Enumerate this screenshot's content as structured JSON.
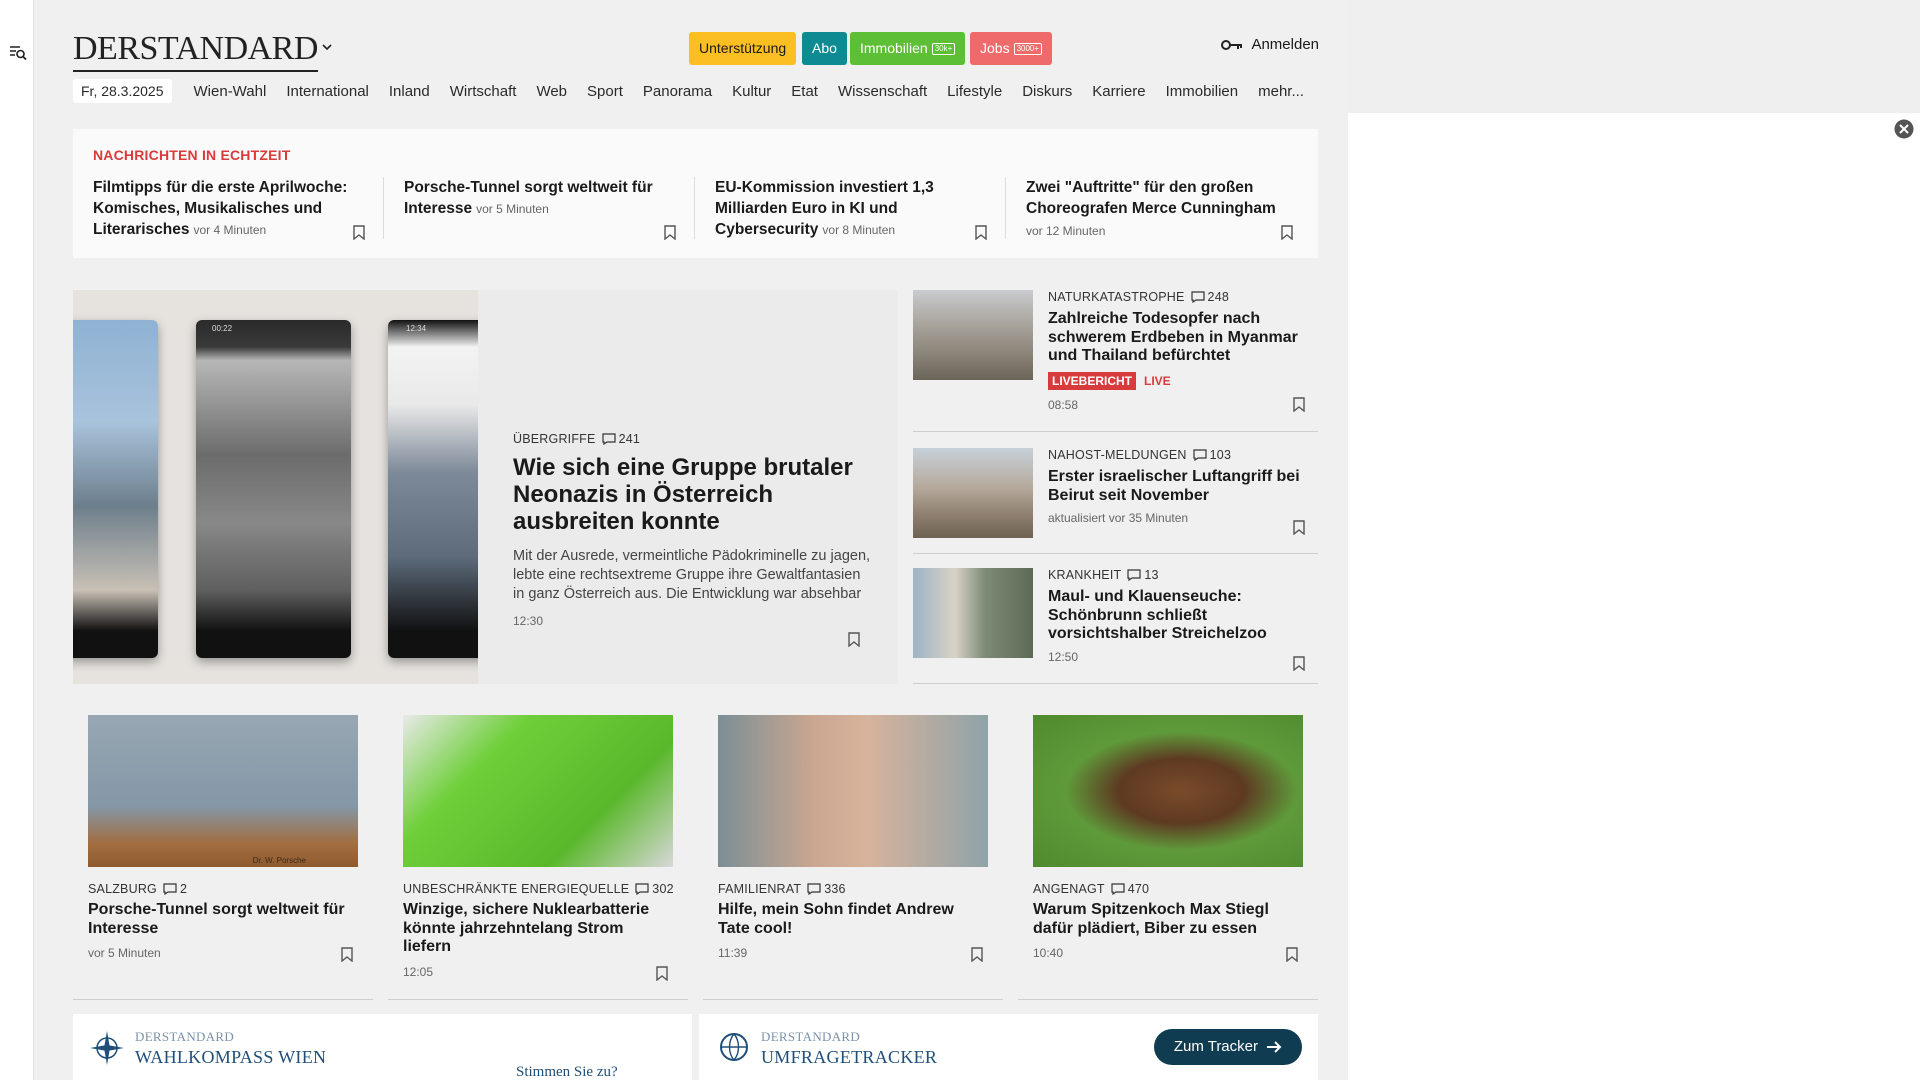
{
  "header": {
    "logo": "DERSTANDARD",
    "promos": [
      {
        "label": "Unterstützung",
        "badge": ""
      },
      {
        "label": "Abo",
        "badge": ""
      },
      {
        "label": "Immobilien",
        "badge": "30k+"
      },
      {
        "label": "Jobs",
        "badge": "3000+"
      }
    ],
    "login_label": "Anmelden"
  },
  "nav": {
    "date": "Fr, 28.3.2025",
    "items": [
      "Wien-Wahl",
      "International",
      "Inland",
      "Wirtschaft",
      "Web",
      "Sport",
      "Panorama",
      "Kultur",
      "Etat",
      "Wissenschaft",
      "Lifestyle",
      "Diskurs",
      "Karriere",
      "Immobilien",
      "mehr..."
    ]
  },
  "ticker": {
    "title": "NACHRICHTEN IN ECHTZEIT",
    "items": [
      {
        "title": "Filmtipps für die erste Aprilwoche: Komisches, Musikalisches und Literarisches",
        "time": "vor 4 Minuten"
      },
      {
        "title": "Porsche-Tunnel sorgt weltweit für Interesse",
        "time": "vor 5 Minuten"
      },
      {
        "title": "EU-Kommission investiert 1,3 Milliarden Euro in KI und Cybersecurity",
        "time": "vor 8 Minuten"
      },
      {
        "title": "Zwei \"Auftritte\" für den großen Choreografen Merce Cunningham",
        "time": "vor 12 Minuten"
      }
    ]
  },
  "hero": {
    "kicker": "ÜBERGRIFFE",
    "comments": "241",
    "title": "Wie sich eine Gruppe brutaler Neonazis in Österreich ausbreiten konnte",
    "lead": "Mit der Ausrede, vermeintliche Pädokriminelle zu jagen, lebte eine rechtsextreme Gruppe ihre Gewaltfantasien in ganz Österreich aus. Die Entwicklung war absehbar",
    "time": "12:30",
    "phone_time": "00:22",
    "phone_time_2": "12:34"
  },
  "side": [
    {
      "kicker": "NATURKATASTROPHE",
      "comments": "248",
      "title": "Zahlreiche Todesopfer nach schwerem Erdbeben in Myanmar und Thailand befürchtet",
      "live_badge": "LIVEBERICHT",
      "live": "LIVE",
      "time": "08:58"
    },
    {
      "kicker": "NAHOST-MELDUNGEN",
      "comments": "103",
      "title": "Erster israelischer Luftangriff bei Beirut seit November",
      "time": "aktualisiert vor 35 Minuten"
    },
    {
      "kicker": "KRANKHEIT",
      "comments": "13",
      "title": "Maul- und Klauenseuche: Schönbrunn schließt vorsichtshalber Streichelzoo",
      "time": "12:50"
    }
  ],
  "cards": [
    {
      "kicker": "SALZBURG",
      "comments": "2",
      "title": "Porsche-Tunnel sorgt weltweit für Interesse",
      "time": "vor 5 Minuten",
      "img_caption": "Dr. W. Porsche"
    },
    {
      "kicker": "UNBESCHRÄNKTE ENERGIEQUELLE",
      "comments": "302",
      "title": "Winzige, sichere Nuklearbatterie könnte jahrzehntelang Strom liefern",
      "time": "12:05"
    },
    {
      "kicker": "FAMILIENRAT",
      "comments": "336",
      "title": "Hilfe, mein Sohn findet Andrew Tate cool!",
      "time": "11:39"
    },
    {
      "kicker": "ANGENAGT",
      "comments": "470",
      "title": "Warum Spitzenkoch Max Stiegl dafür plädiert, Biber zu essen",
      "time": "10:40"
    }
  ],
  "widgets": {
    "left": {
      "brand_small": "DERSTANDARD",
      "brand": "WAHLKOMPASS WIEN",
      "prompt": "Stimmen Sie zu?"
    },
    "right": {
      "brand_small": "DERSTANDARD",
      "brand": "UMFRAGETRACKER",
      "button": "Zum Tracker"
    }
  },
  "colors": {
    "accent_red": "#d83b3b",
    "teal": "#0e8b92",
    "navy": "#0f3c50"
  }
}
